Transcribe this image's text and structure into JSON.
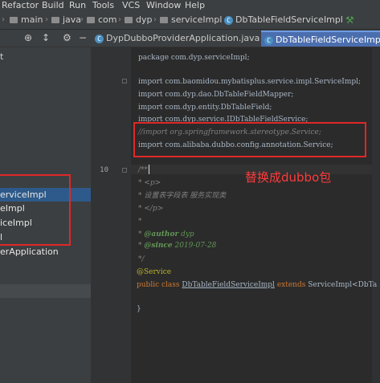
{
  "menu": [
    "Refactor",
    "Build",
    "Run",
    "Tools",
    "VCS",
    "Window",
    "Help"
  ],
  "breadcrumb": [
    "main",
    "java",
    "com",
    "dyp",
    "serviceImpl",
    "DbTableFieldServiceImpl"
  ],
  "tabs": [
    {
      "label": "DypDubboProviderApplication.java",
      "active": false
    },
    {
      "label": "DbTableFieldServiceImpl",
      "active": true
    }
  ],
  "project_tree": {
    "top_partial": "t",
    "items": [
      "erviceImpl",
      "eImpl",
      "iceImpl",
      "l",
      "erApplication"
    ]
  },
  "gutter_current_line": "10",
  "code": {
    "package": "package com.dyp.serviceImpl;",
    "imports": [
      "import com.baomidou.mybatisplus.service.impl.ServiceImpl;",
      "import com.dyp.dao.DbTableFieldMapper;",
      "import com.dyp.entity.DbTableField;",
      "import com.dyp.service.IDbTableFieldService;"
    ],
    "commented_import": "//import org.springframework.stereotype.Service;",
    "dubbo_import": "import com.alibaba.dubbo.config.annotation.Service;",
    "javadoc": {
      "open": "/**",
      "p_open": "* <p>",
      "desc": "* 设置表字段表 服务实现类",
      "p_close": "* </p>",
      "blank": "*",
      "author_tag": "@author",
      "author_val": "dyp",
      "since_tag": "@since",
      "since_val": "2019-07-28",
      "close": "*/"
    },
    "annotation": "@Service",
    "class_decl": {
      "prefix": "public class",
      "name": "DbTableFieldServiceImpl",
      "extends": "extends",
      "parent": "ServiceImpl<DbTa"
    },
    "closing_brace": "}"
  },
  "annotation_note": "替换成dubbo包",
  "colors": {
    "highlight_red": "#e02828",
    "active_tab": "#4b6eaf",
    "keyword": "#cc7832"
  }
}
